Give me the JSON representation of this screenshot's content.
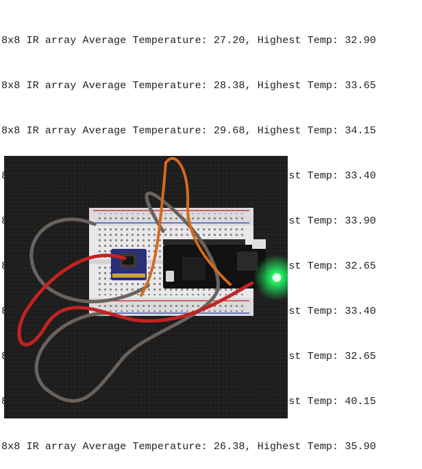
{
  "console": {
    "lines": [
      "8x8 IR array Average Temperature: 27.20, Highest Temp: 32.90",
      "8x8 IR array Average Temperature: 28.38, Highest Temp: 33.65",
      "8x8 IR array Average Temperature: 29.68, Highest Temp: 34.15",
      "8x8 IR array Average Temperature: 26.71, Highest Temp: 33.40",
      "8x8 IR array Average Temperature: 27.10, Highest Temp: 33.90",
      "8x8 IR array Average Temperature: 27.39, Highest Temp: 32.65",
      "8x8 IR array Average Temperature: 26.58, Highest Temp: 33.40",
      "8x8 IR array Average Temperature: 26.15, Highest Temp: 32.65",
      "8x8 IR array Average Temperature: 27.38, Highest Temp: 40.15",
      "8x8 IR array Average Temperature: 26.38, Highest Temp: 35.90"
    ]
  },
  "photo": {
    "subject": "breadboard-with-ir-sensor-and-microcontroller",
    "colors": {
      "background": "#1d1d1d",
      "breadboard": "#e9e7ea",
      "rail_red": "#c43a3a",
      "rail_blue": "#4058b0",
      "sensor_board": "#2a2f7a",
      "mcu_board": "#111111",
      "wire_gray": "#6b625c",
      "wire_red": "#c42222",
      "wire_orange": "#d46a1c",
      "led_green": "#22ff66"
    }
  }
}
